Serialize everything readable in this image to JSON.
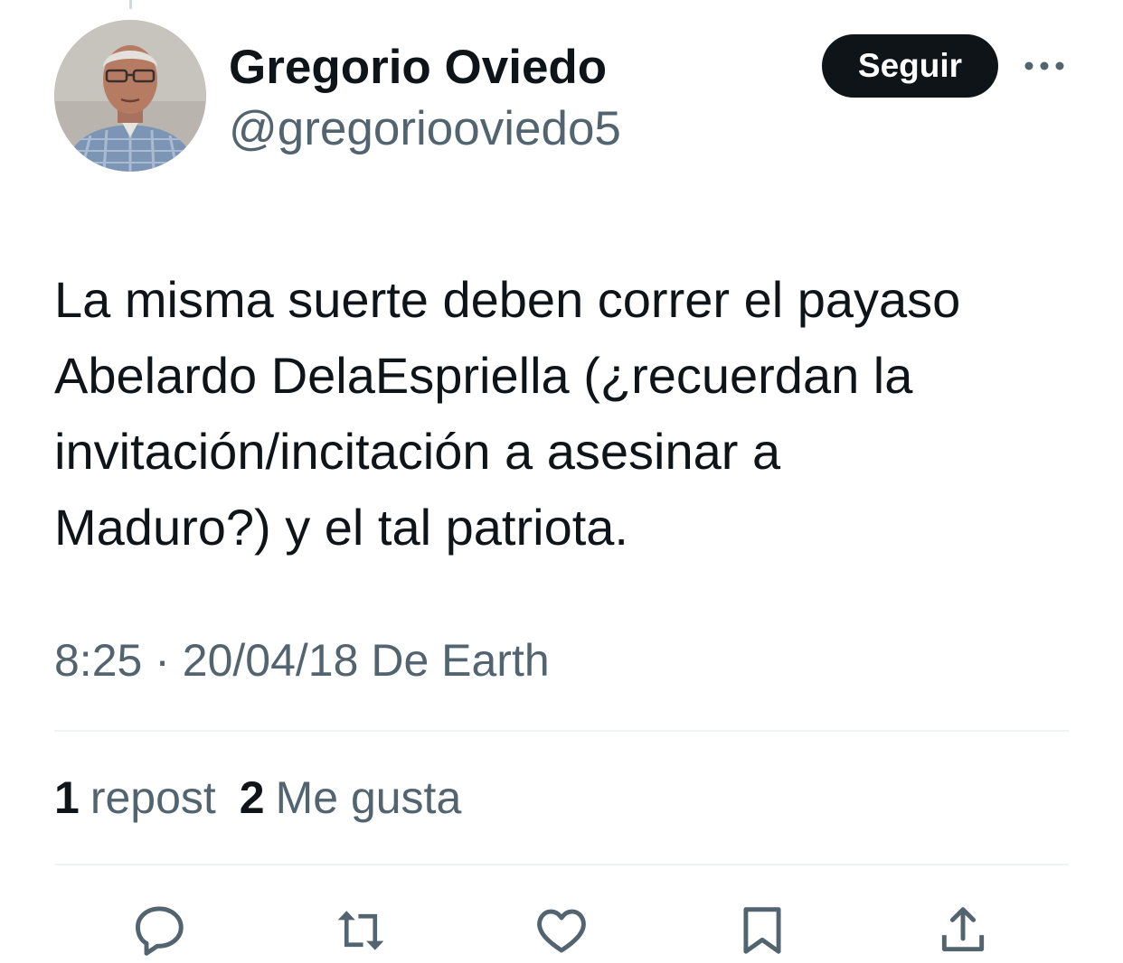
{
  "author": {
    "display_name": "Gregorio Oviedo",
    "handle": "@gregoriooviedo5",
    "avatar_icon": "user-avatar-photo"
  },
  "header": {
    "follow_label": "Seguir",
    "more_icon": "more-horizontal-icon"
  },
  "tweet": {
    "text_lines": [
      "La misma suerte deben correr el payaso",
      "Abelardo DelaEspriella (¿recuerdan la",
      "invitación/incitación a asesinar a",
      "Maduro?) y el tal patriota."
    ],
    "time": "8:25",
    "separator": "·",
    "date": "20/04/18",
    "source": "De Earth"
  },
  "stats": {
    "reposts_count": "1",
    "reposts_label": "repost",
    "likes_count": "2",
    "likes_label": "Me gusta"
  },
  "actions": [
    {
      "icon": "reply-icon"
    },
    {
      "icon": "repost-icon"
    },
    {
      "icon": "like-icon"
    },
    {
      "icon": "bookmark-icon"
    },
    {
      "icon": "share-icon"
    }
  ],
  "colors": {
    "text_primary": "#0f1419",
    "text_secondary": "#536471",
    "divider": "#eff3f4",
    "button_bg": "#0f1419",
    "button_text": "#ffffff"
  }
}
